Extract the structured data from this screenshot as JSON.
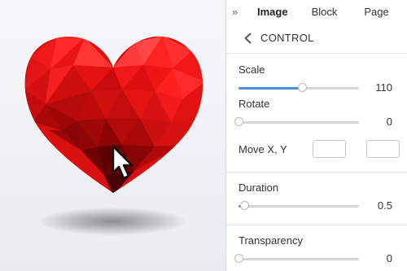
{
  "panel": {
    "collapse_icon": "»",
    "tabs": [
      {
        "label": "Image",
        "active": true
      },
      {
        "label": "Block",
        "active": false
      },
      {
        "label": "Page",
        "active": false
      }
    ],
    "subheader": {
      "back_icon": "chevron-left-icon",
      "label": "CONTROL"
    },
    "scale": {
      "label": "Scale",
      "value": "110",
      "level": 0.53
    },
    "rotate": {
      "label": "Rotate",
      "value": "0",
      "level": 0
    },
    "move": {
      "label": "Move X, Y",
      "x_value": "",
      "y_value": ""
    },
    "duration": {
      "label": "Duration",
      "value": "0.5",
      "level": 0.05
    },
    "transparency": {
      "label": "Transparency",
      "value": "0",
      "level": 0
    }
  },
  "colors": {
    "accent": "#4a90e2",
    "heart_base": "#e01010",
    "panel_bg": "#ffffff",
    "canvas_bg": "#eceef1"
  },
  "icons": [
    "double-chevron-right-icon",
    "chevron-left-icon",
    "mouse-pointer-icon"
  ]
}
